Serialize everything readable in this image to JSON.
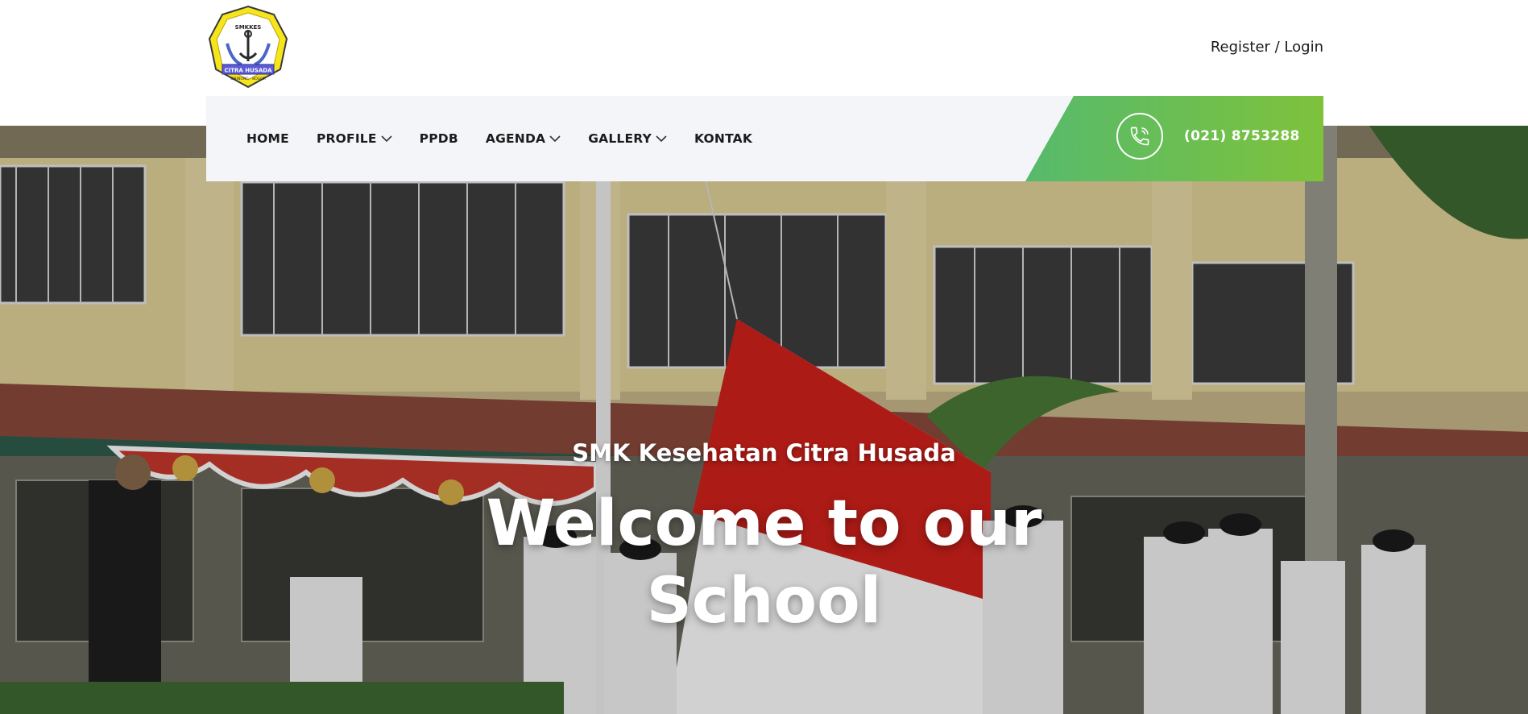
{
  "header": {
    "logo": {
      "top_text": "SMKKES",
      "ribbon": "CITRA HUSADA",
      "bottom_text": "CIBINONG - BOGOR"
    },
    "auth_link": "Register / Login"
  },
  "nav": {
    "items": [
      {
        "label": "HOME",
        "dropdown": false
      },
      {
        "label": "PROFILE",
        "dropdown": true
      },
      {
        "label": "PPDB",
        "dropdown": false
      },
      {
        "label": "AGENDA",
        "dropdown": true
      },
      {
        "label": "GALLERY",
        "dropdown": true
      },
      {
        "label": "KONTAK",
        "dropdown": false
      }
    ],
    "phone_icon": "phone-icon",
    "phone": "(021) 8753288"
  },
  "hero": {
    "subtitle": "SMK Kesehatan Citra Husada",
    "title_line1": "Welcome to our",
    "title_line2": "School"
  },
  "colors": {
    "phone_gradient_start": "#56ba6c",
    "phone_gradient_end": "#7ec23c",
    "nav_bg": "#f4f5f8",
    "logo_yellow": "#f6e51c"
  }
}
